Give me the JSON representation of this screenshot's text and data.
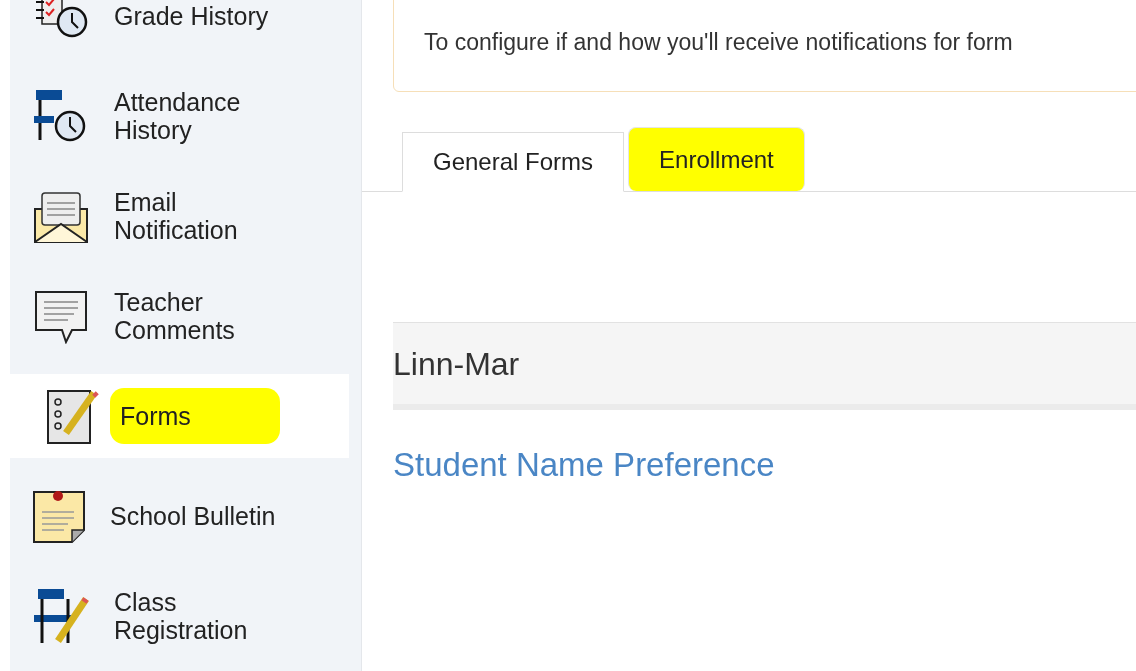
{
  "sidebar": {
    "items": [
      {
        "label": "Grade History",
        "selected": false,
        "highlighted": false
      },
      {
        "label": "Attendance History",
        "selected": false,
        "highlighted": false
      },
      {
        "label": "Email Notification",
        "selected": false,
        "highlighted": false
      },
      {
        "label": "Teacher Comments",
        "selected": false,
        "highlighted": false
      },
      {
        "label": "Forms",
        "selected": true,
        "highlighted": true
      },
      {
        "label": "School Bulletin",
        "selected": false,
        "highlighted": false
      },
      {
        "label": "Class Registration",
        "selected": false,
        "highlighted": false
      }
    ]
  },
  "notice": {
    "text": "To configure if and how you'll receive notifications for form"
  },
  "tabs": [
    {
      "label": "General Forms",
      "selected": true,
      "highlighted": false
    },
    {
      "label": "Enrollment",
      "selected": false,
      "highlighted": true
    }
  ],
  "section": {
    "title": "Linn-Mar",
    "links": [
      "Student Name Preference"
    ]
  }
}
